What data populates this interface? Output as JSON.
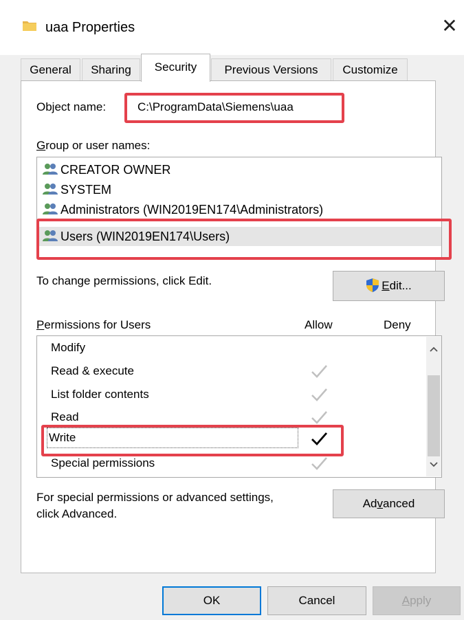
{
  "window": {
    "title": "uaa Properties",
    "close_symbol": "✕"
  },
  "tabs": [
    {
      "label": "General"
    },
    {
      "label": "Sharing"
    },
    {
      "label": "Security",
      "active": true
    },
    {
      "label": "Previous Versions"
    },
    {
      "label": "Customize"
    }
  ],
  "object": {
    "label": "Object name:",
    "value": "C:\\ProgramData\\Siemens\\uaa"
  },
  "group": {
    "label_accel": "G",
    "label_rest": "roup or user names:",
    "users": [
      "CREATOR OWNER",
      "SYSTEM",
      "Administrators (WIN2019EN174\\Administrators)",
      "Users (WIN2019EN174\\Users)"
    ],
    "selected_index": 3
  },
  "change_hint": "To change permissions, click Edit.",
  "edit_button": {
    "accel": "E",
    "rest": "dit..."
  },
  "permissions": {
    "label_accel": "P",
    "label_rest": "ermissions for Users",
    "allow_header": "Allow",
    "deny_header": "Deny",
    "rows": [
      {
        "name": "Modify",
        "allow": "none"
      },
      {
        "name": "Read & execute",
        "allow": "inherited"
      },
      {
        "name": "List folder contents",
        "allow": "inherited"
      },
      {
        "name": "Read",
        "allow": "inherited"
      },
      {
        "name": "Write",
        "allow": "explicit"
      },
      {
        "name": "Special permissions",
        "allow": "inherited"
      }
    ]
  },
  "advanced": {
    "hint_line1": "For special permissions or advanced settings,",
    "hint_line2": "click Advanced.",
    "button_pre": "Ad",
    "button_accel": "v",
    "button_post": "anced"
  },
  "footer": {
    "ok": "OK",
    "cancel": "Cancel",
    "apply_accel": "A",
    "apply_rest": "pply"
  },
  "colors": {
    "highlight_box": "#e4414c",
    "selection": "#e5e5e5",
    "focus_border": "#0078d7"
  }
}
